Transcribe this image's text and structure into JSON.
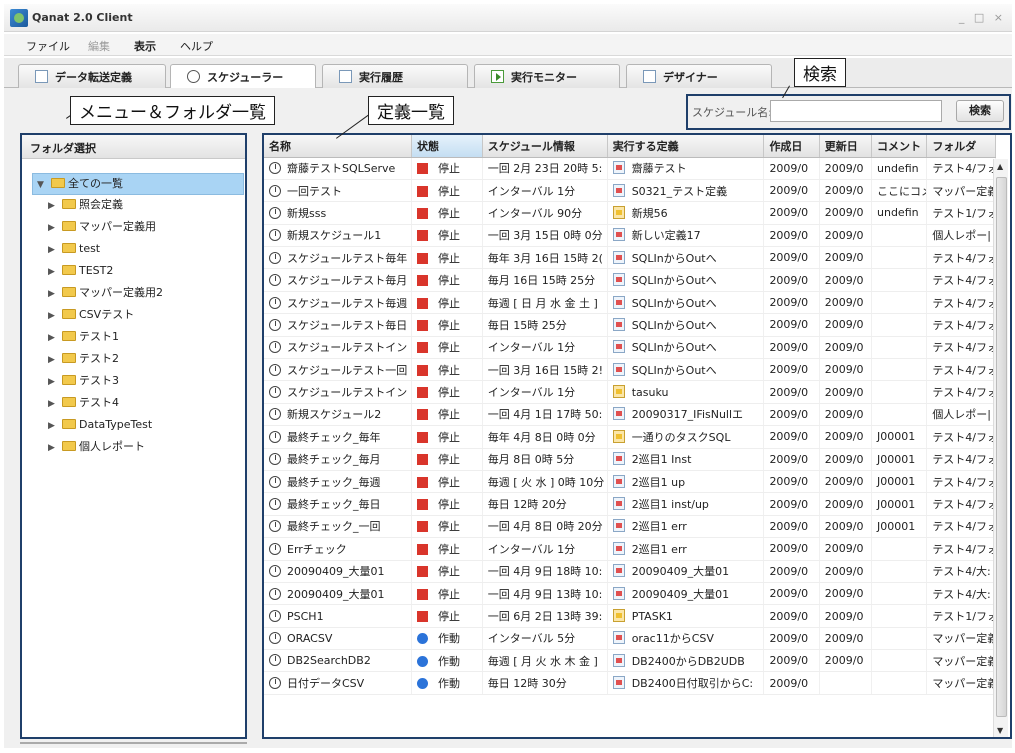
{
  "window": {
    "title": "Qanat 2.0 Client",
    "controls": "_ □ ×"
  },
  "menu": [
    {
      "label": "ファイル",
      "disabled": false
    },
    {
      "label": "編集",
      "disabled": true
    },
    {
      "label": "表示",
      "disabled": false
    },
    {
      "label": "ヘルプ",
      "disabled": false
    }
  ],
  "tabs": [
    {
      "label": "データ転送定義",
      "icon": "document-icon"
    },
    {
      "label": "スケジューラー",
      "icon": "clock-icon"
    },
    {
      "label": "実行履歴",
      "icon": "document-icon"
    },
    {
      "label": "実行モニター",
      "icon": "play-icon"
    },
    {
      "label": "デザイナー",
      "icon": "designer-icon"
    }
  ],
  "annotations": {
    "menu_folder": "メニュー＆フォルダ一覧",
    "definitions": "定義一覧",
    "search": "検索"
  },
  "search": {
    "label": "スケジュール名:",
    "value": "",
    "button": "検索"
  },
  "folder_panel": {
    "header": "フォルダ選択",
    "items": [
      {
        "label": "全ての一覧",
        "expanded": true,
        "selected": true,
        "level": 0
      },
      {
        "label": "照会定義",
        "level": 1
      },
      {
        "label": "マッパー定義用",
        "level": 1
      },
      {
        "label": "test",
        "level": 1
      },
      {
        "label": "TEST2",
        "level": 1
      },
      {
        "label": "マッパー定義用2",
        "level": 1
      },
      {
        "label": "CSVテスト",
        "level": 1
      },
      {
        "label": "テスト1",
        "level": 1
      },
      {
        "label": "テスト2",
        "level": 1
      },
      {
        "label": "テスト3",
        "level": 1
      },
      {
        "label": "テスト4",
        "level": 1
      },
      {
        "label": "DataTypeTest",
        "level": 1
      },
      {
        "label": "個人レポート",
        "level": 1
      }
    ]
  },
  "grid": {
    "columns": [
      "名称",
      "状態",
      "スケジュール情報",
      "実行する定義",
      "作成日",
      "更新日",
      "コメント",
      "フォルダ"
    ],
    "rows": [
      [
        "齋藤テストSQLServe",
        "停止",
        "一回 2月 23日 20時 5:",
        "齋藤テスト",
        "2009/0",
        "2009/0",
        "undefin",
        "テスト4/フォ",
        "stop",
        "def"
      ],
      [
        "一回テスト",
        "停止",
        "インターバル 1分",
        "S0321_テスト定義",
        "2009/0",
        "2009/0",
        "ここにコメ",
        "マッパー定義",
        "stop",
        "def"
      ],
      [
        "新規sss",
        "停止",
        "インターバル 90分",
        "新規56",
        "2009/0",
        "2009/0",
        "undefin",
        "テスト1/フォ",
        "stop",
        "task"
      ],
      [
        "新規スケジュール1",
        "停止",
        "一回 3月 15日 0時 0分",
        "新しい定義17",
        "2009/0",
        "2009/0",
        "",
        "個人レポー|",
        "stop",
        "def"
      ],
      [
        "スケジュールテスト毎年",
        "停止",
        "毎年 3月 16日 15時 2(",
        "SQLInからOutへ",
        "2009/0",
        "2009/0",
        "",
        "テスト4/フォ",
        "stop",
        "def"
      ],
      [
        "スケジュールテスト毎月",
        "停止",
        "毎月 16日 15時 25分",
        "SQLInからOutへ",
        "2009/0",
        "2009/0",
        "",
        "テスト4/フォ",
        "stop",
        "def"
      ],
      [
        "スケジュールテスト毎週",
        "停止",
        "毎週 [ 日 月 水 金 土 ]",
        "SQLInからOutへ",
        "2009/0",
        "2009/0",
        "",
        "テスト4/フォ",
        "stop",
        "def"
      ],
      [
        "スケジュールテスト毎日",
        "停止",
        "毎日 15時 25分",
        "SQLInからOutへ",
        "2009/0",
        "2009/0",
        "",
        "テスト4/フォ",
        "stop",
        "def"
      ],
      [
        "スケジュールテストイン",
        "停止",
        "インターバル 1分",
        "SQLInからOutへ",
        "2009/0",
        "2009/0",
        "",
        "テスト4/フォ",
        "stop",
        "def"
      ],
      [
        "スケジュールテスト一回",
        "停止",
        "一回 3月 16日 15時 2!",
        "SQLInからOutへ",
        "2009/0",
        "2009/0",
        "",
        "テスト4/フォ",
        "stop",
        "def"
      ],
      [
        "スケジュールテストイン",
        "停止",
        "インターバル 1分",
        "tasuku",
        "2009/0",
        "2009/0",
        "",
        "テスト4/フォ",
        "stop",
        "task"
      ],
      [
        "新規スケジュール2",
        "停止",
        "一回 4月 1日 17時 50:",
        "20090317_IFisNullエ",
        "2009/0",
        "2009/0",
        "",
        "個人レポー|",
        "stop",
        "def"
      ],
      [
        "最終チェック_毎年",
        "停止",
        "毎年 4月 8日 0時 0分",
        "一通りのタスクSQL",
        "2009/0",
        "2009/0",
        "J00001",
        "テスト4/フォ",
        "stop",
        "task"
      ],
      [
        "最終チェック_毎月",
        "停止",
        "毎月 8日 0時 5分",
        "2巡目1 Inst",
        "2009/0",
        "2009/0",
        "J00001",
        "テスト4/フォ",
        "stop",
        "def"
      ],
      [
        "最終チェック_毎週",
        "停止",
        "毎週 [ 火 水 ] 0時 10分",
        "2巡目1 up",
        "2009/0",
        "2009/0",
        "J00001",
        "テスト4/フォ",
        "stop",
        "def"
      ],
      [
        "最終チェック_毎日",
        "停止",
        "毎日 12時 20分",
        "2巡目1 inst/up",
        "2009/0",
        "2009/0",
        "J00001",
        "テスト4/フォ",
        "stop",
        "def"
      ],
      [
        "最終チェック_一回",
        "停止",
        "一回 4月 8日 0時 20分",
        "2巡目1 err",
        "2009/0",
        "2009/0",
        "J00001",
        "テスト4/フォ",
        "stop",
        "def"
      ],
      [
        "Errチェック",
        "停止",
        "インターバル 1分",
        "2巡目1 err",
        "2009/0",
        "2009/0",
        "",
        "テスト4/フォ",
        "stop",
        "def"
      ],
      [
        "20090409_大量01",
        "停止",
        "一回 4月 9日 18時 10:",
        "20090409_大量01",
        "2009/0",
        "2009/0",
        "",
        "テスト4/大:",
        "stop",
        "def"
      ],
      [
        "20090409_大量01",
        "停止",
        "一回 4月 9日 13時 10:",
        "20090409_大量01",
        "2009/0",
        "2009/0",
        "",
        "テスト4/大:",
        "stop",
        "def"
      ],
      [
        "PSCH1",
        "停止",
        "一回 6月 2日 13時 39:",
        "PTASK1",
        "2009/0",
        "2009/0",
        "",
        "テスト1/フォ",
        "stop",
        "task"
      ],
      [
        "ORACSV",
        "作動",
        "インターバル 5分",
        "orac11からCSV",
        "2009/0",
        "2009/0",
        "",
        "マッパー定義",
        "run",
        "def"
      ],
      [
        "DB2SearchDB2",
        "作動",
        "毎週 [ 月 火 水 木 金 ]",
        "DB2400からDB2UDB",
        "2009/0",
        "2009/0",
        "",
        "マッパー定義",
        "run",
        "def"
      ],
      [
        "日付データCSV",
        "作動",
        "毎日 12時 30分",
        "DB2400日付取引からC:",
        "2009/0",
        "",
        "",
        "マッパー定義",
        "run",
        "def"
      ]
    ]
  },
  "colors": {
    "accent": "#1f3f6a",
    "stop": "#d9352b",
    "run": "#2b73d9",
    "selected": "#a9d4f4"
  }
}
